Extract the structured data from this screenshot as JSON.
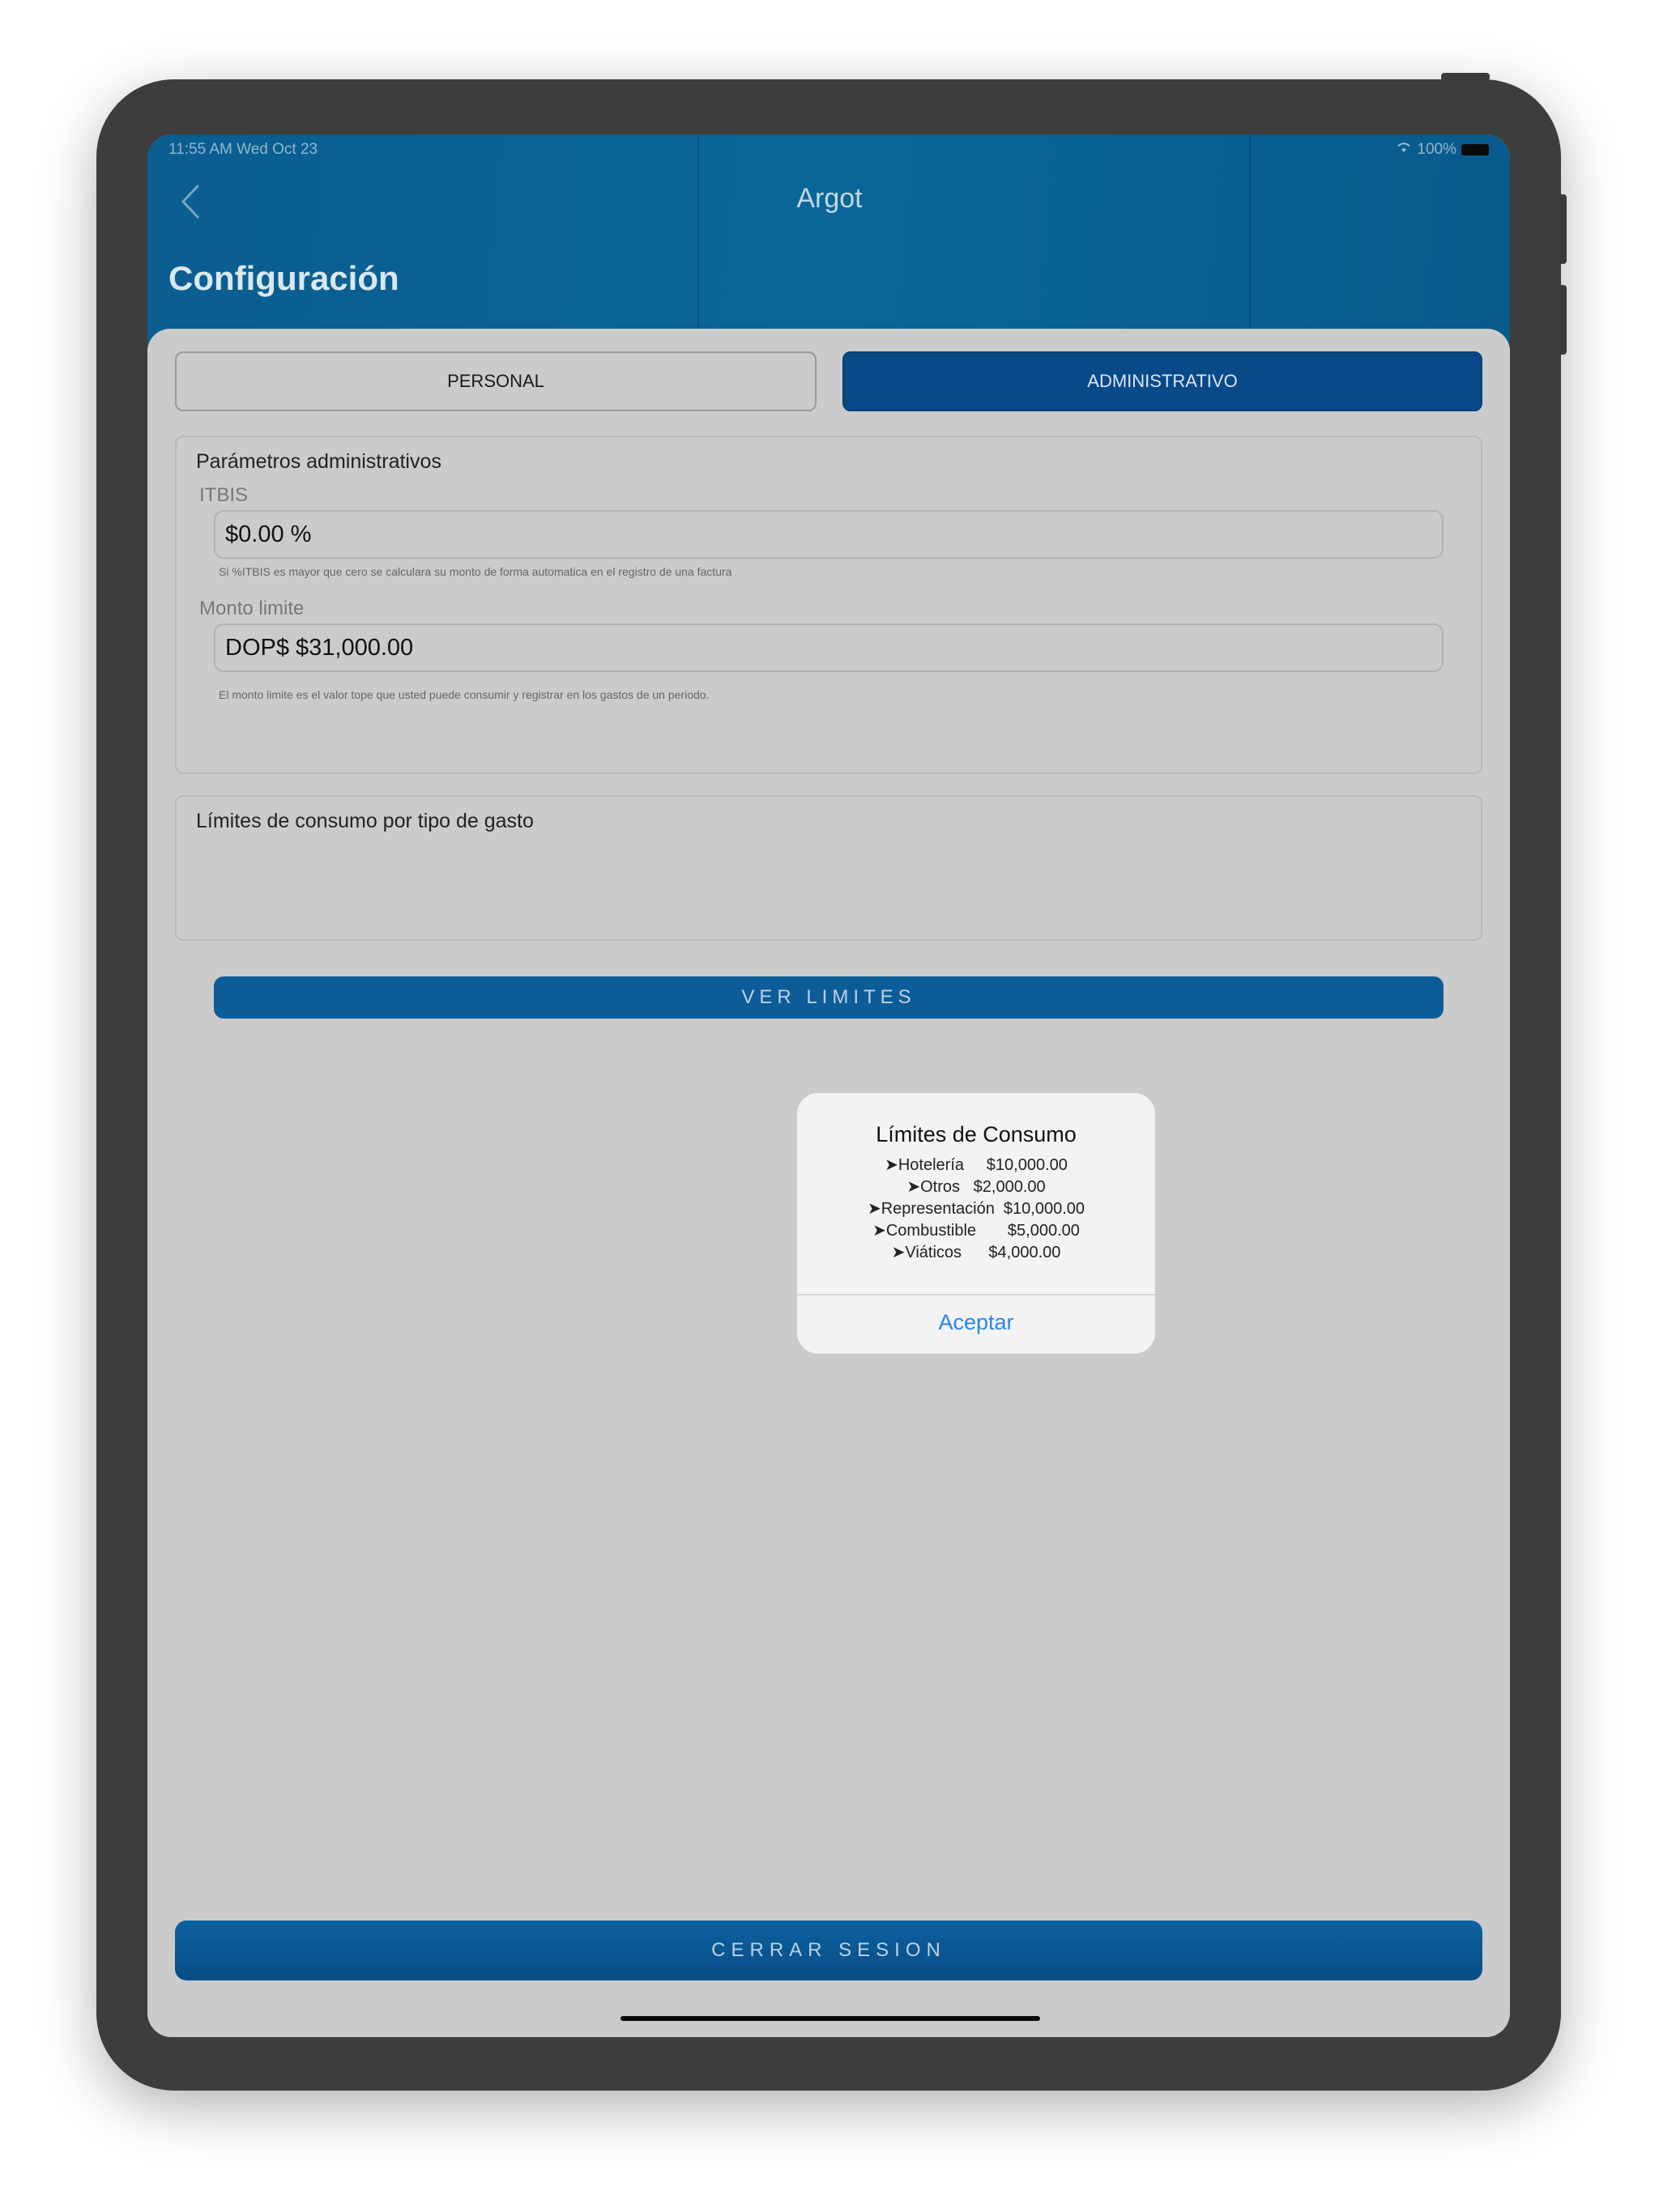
{
  "status_bar": {
    "time_date": "11:55 AM   Wed Oct 23",
    "battery_text": "100%"
  },
  "nav": {
    "app_title": "Argot",
    "page_title": "Configuración"
  },
  "segments": {
    "personal": "PERSONAL",
    "admin": "ADMINISTRATIVO"
  },
  "admin_params": {
    "title": "Parámetros administrativos",
    "itbis_label": "ITBIS",
    "itbis_value": "$0.00 %",
    "itbis_hint": "Si %ITBIS es mayor que cero se calculara su monto de forma automatica  en el registro de una factura",
    "limit_label": "Monto limite",
    "limit_value": "DOP$ $31,000.00",
    "limit_hint": "El monto limite  es el valor tope que usted puede consumir y registrar en los gastos de un periodo."
  },
  "limits_section": {
    "title": "Límites de consumo por tipo de gasto",
    "button": "VER LIMITES"
  },
  "dialog": {
    "title": "Límites de Consumo",
    "lines": [
      "➤Hotelería     $10,000.00",
      "➤Otros   $2,000.00",
      "➤Representación  $10,000.00",
      "➤Combustible       $5,000.00",
      "➤Viáticos      $4,000.00"
    ],
    "ok": "Aceptar"
  },
  "footer": {
    "logout": "CERRAR SESION"
  },
  "colors": {
    "header_blue": "#0a6699",
    "active_segment": "#084a88",
    "link_blue": "#2b86e6",
    "background_gray": "#cbcbcb"
  }
}
